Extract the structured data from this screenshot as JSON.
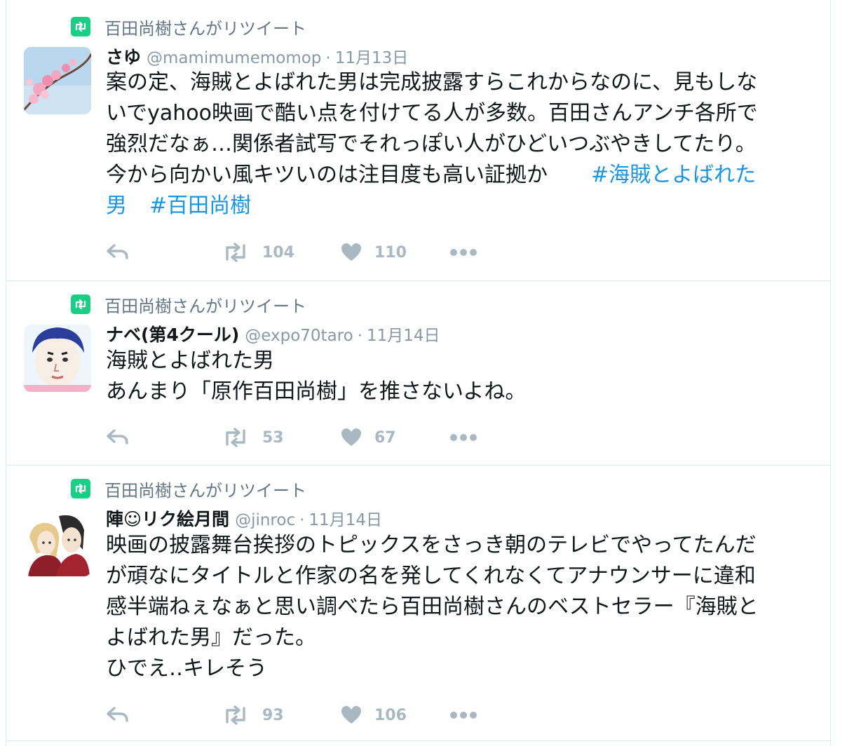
{
  "colors": {
    "retweet_green": "#19cf86",
    "hashtag_blue": "#1b95e0",
    "muted": "#8899a6",
    "action_gray": "#aab8c2"
  },
  "tweets": [
    {
      "context": "百田尚樹さんがリツイート",
      "fullname": "さゆ",
      "username": "@mamimumemomop",
      "sep": "·",
      "time": "11月13日",
      "avatar": "cherry-blossom-avatar",
      "lines": [
        "案の定、海賊とよばれた男は完成披露すらこれからなのに、見もしな",
        "いでyahoo映画で酷い点を付けてる人が多数。百田さんアンチ各所で",
        "強烈だなぁ…関係者試写でそれっぽい人がひどいつぶやきしてたり。"
      ],
      "line4": "今から向かい風キツいのは注目度も高い証拠か",
      "hashtag1": "#海賊とよばれた",
      "hashtag1_cont": "男",
      "hashtag2": "#百田尚樹",
      "retweets": "104",
      "likes": "110"
    },
    {
      "context": "百田尚樹さんがリツイート",
      "fullname": "ナベ(第4クール)",
      "username": "@expo70taro",
      "sep": "·",
      "time": "11月14日",
      "avatar": "cartoon-face-avatar",
      "lines": [
        "海賊とよばれた男",
        "あんまり「原作百田尚樹」を推さないよね。"
      ],
      "retweets": "53",
      "likes": "67"
    },
    {
      "context": "百田尚樹さんがリツイート",
      "fullname": "陣☺リク絵月間",
      "username": "@jinroc",
      "sep": "·",
      "time": "11月14日",
      "avatar": "anime-couple-avatar",
      "lines": [
        "映画の披露舞台挨拶のトピックスをさっき朝のテレビでやってたんだ",
        "が頑なにタイトルと作家の名を発してくれなくてアナウンサーに違和",
        "感半端ねぇなぁと思い調べたら百田尚樹さんのベストセラー『海賊と",
        "よばれた男』だった。",
        "ひでえ‥キレそう"
      ],
      "retweets": "93",
      "likes": "106"
    }
  ]
}
